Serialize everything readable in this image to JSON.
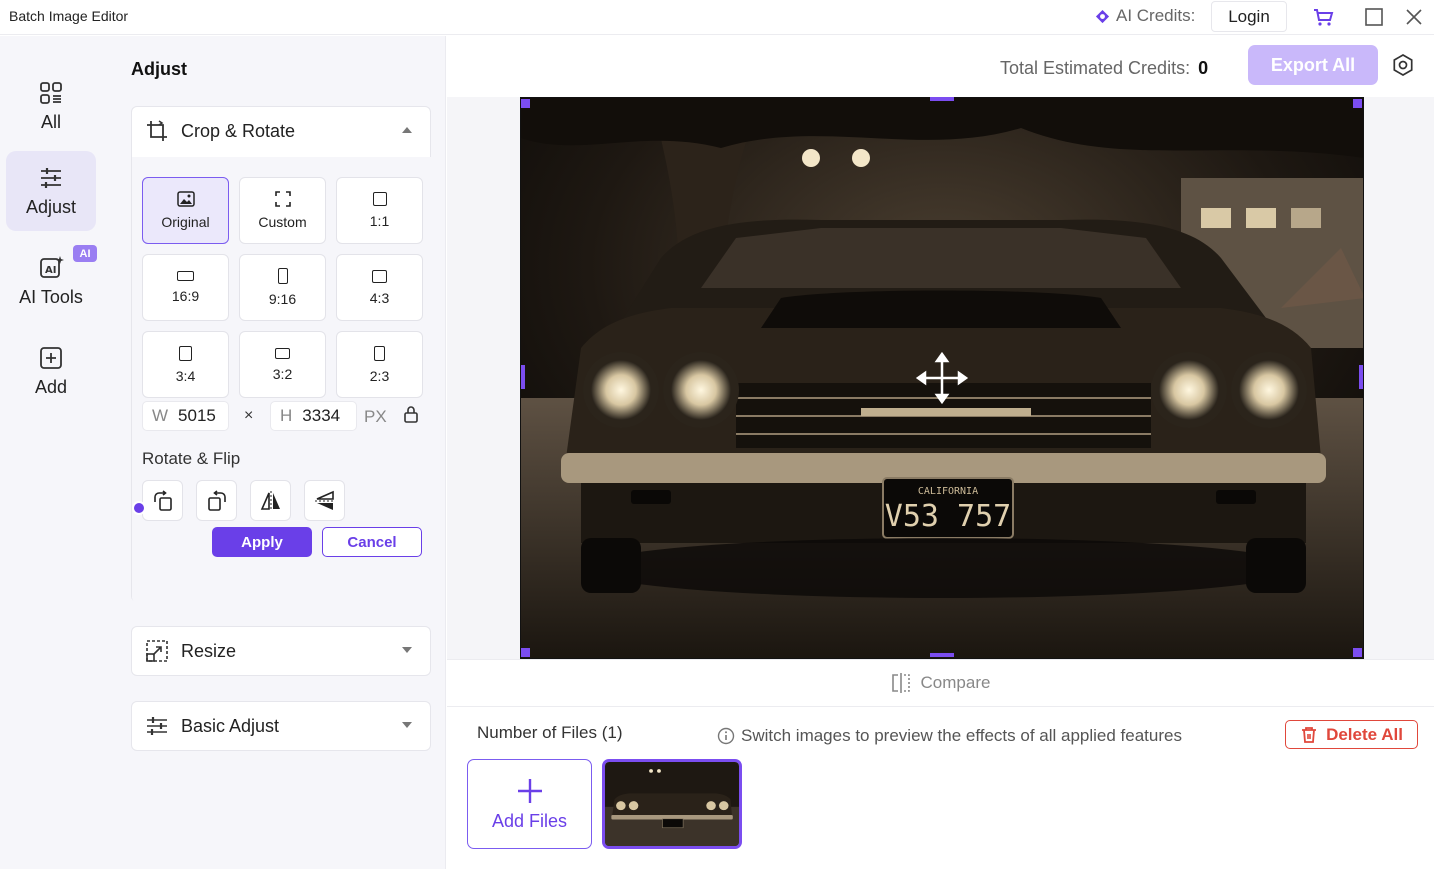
{
  "app": {
    "title": "Batch Image Editor"
  },
  "titlebar": {
    "credits_label": "AI Credits:",
    "login_label": "Login"
  },
  "rail": {
    "items": [
      {
        "label": "All"
      },
      {
        "label": "Adjust"
      },
      {
        "label": "AI Tools",
        "badge": "AI"
      },
      {
        "label": "Add"
      }
    ]
  },
  "panel": {
    "title": "Adjust",
    "crop": {
      "title": "Crop & Rotate",
      "ratios": [
        {
          "label": "Original"
        },
        {
          "label": "Custom"
        },
        {
          "label": "1:1"
        },
        {
          "label": "16:9"
        },
        {
          "label": "9:16"
        },
        {
          "label": "4:3"
        },
        {
          "label": "3:4"
        },
        {
          "label": "3:2"
        },
        {
          "label": "2:3"
        }
      ],
      "width_label": "W",
      "width_value": "5015",
      "times": "×",
      "height_label": "H",
      "height_value": "3334",
      "unit": "PX",
      "rotate_title": "Rotate & Flip",
      "apply_label": "Apply",
      "cancel_label": "Cancel"
    },
    "resize_title": "Resize",
    "basic_title": "Basic Adjust"
  },
  "main": {
    "total_credits_label": "Total Estimated Credits:",
    "total_credits_value": "0",
    "export_label": "Export All",
    "compare_label": "Compare",
    "files_label": "Number of Files (1)",
    "hint": "Switch images to preview the effects of all applied features",
    "delete_label": "Delete All",
    "add_files_label": "Add Files",
    "plate_state": "CALIFORNIA",
    "plate_number": "V53 757"
  },
  "colors": {
    "accent": "#6a3fe8",
    "accent_light": "#c9b8fa",
    "danger": "#e0473b"
  }
}
